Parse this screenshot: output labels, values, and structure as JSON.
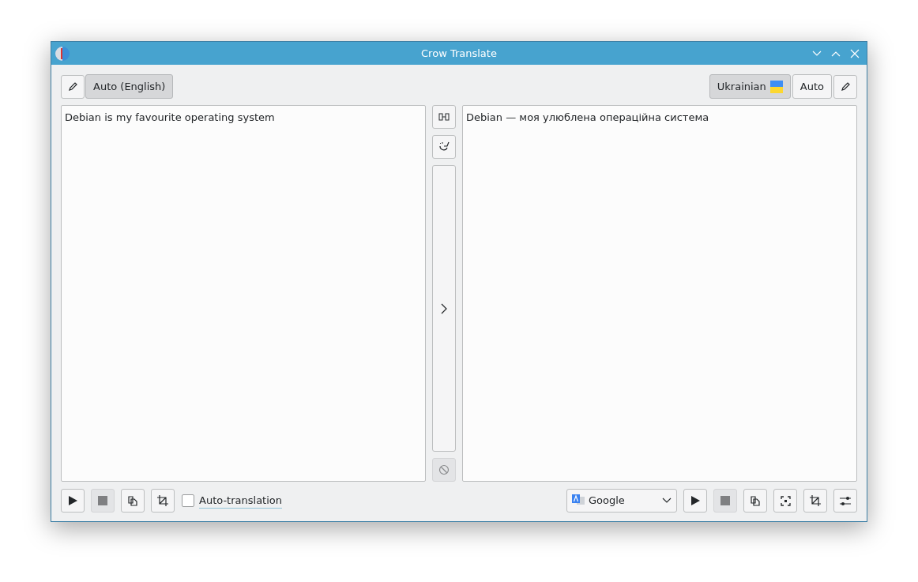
{
  "window": {
    "title": "Crow Translate"
  },
  "source_languages": [
    {
      "label": "Auto (English)",
      "selected": true
    }
  ],
  "target_languages": [
    {
      "label": "Ukrainian",
      "selected": true,
      "flag": true
    },
    {
      "label": "Auto",
      "selected": false,
      "flag": false
    }
  ],
  "source_text": "Debian is my favourite operating system",
  "translation_text": "Debian — моя улюблена операційна система",
  "middle_buttons": [
    {
      "kind": "swap",
      "disabled": false
    },
    {
      "kind": "clear",
      "disabled": false
    },
    {
      "kind": "translate",
      "disabled": false
    },
    {
      "kind": "abort",
      "disabled": true
    }
  ],
  "source_controls": [
    {
      "kind": "play",
      "disabled": false
    },
    {
      "kind": "stop",
      "disabled": true
    },
    {
      "kind": "copy",
      "disabled": false
    },
    {
      "kind": "crop",
      "disabled": false
    }
  ],
  "auto_translation": {
    "label": "Auto-translation",
    "checked": false
  },
  "engine": {
    "value": "Google"
  },
  "translation_controls": [
    {
      "kind": "play",
      "disabled": false
    },
    {
      "kind": "stop",
      "disabled": true
    },
    {
      "kind": "copy",
      "disabled": false
    },
    {
      "kind": "capture",
      "disabled": false
    },
    {
      "kind": "crop",
      "disabled": false
    },
    {
      "kind": "settings",
      "disabled": false
    }
  ]
}
